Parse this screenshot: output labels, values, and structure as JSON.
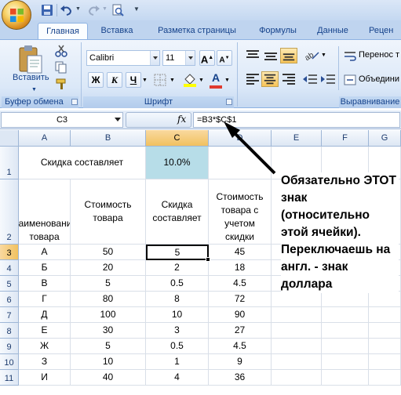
{
  "title_bar": {
    "office_button": "office-logo-icon",
    "quick_access": [
      "save-icon",
      "undo-icon",
      "redo-icon",
      "print-preview-icon",
      "customize-icon"
    ]
  },
  "tabs": [
    "Главная",
    "Вставка",
    "Разметка страницы",
    "Формулы",
    "Данные",
    "Рецен"
  ],
  "ribbon": {
    "clipboard": {
      "paste_label": "Вставить",
      "group_label": "Буфер обмена"
    },
    "font": {
      "font_name": "Calibri",
      "font_size": "11",
      "group_label": "Шрифт",
      "bold": "Ж",
      "italic": "К",
      "underline": "Ч",
      "font_color": "#e03a2f"
    },
    "alignment": {
      "wrap_text": "Перенос т",
      "merge": "Объедини",
      "group_label": "Выравнивание"
    }
  },
  "formula_bar": {
    "name_box": "C3",
    "fx": "fx",
    "formula": "=B3*$C$1"
  },
  "columns": [
    "A",
    "B",
    "C",
    "D",
    "E",
    "F",
    "G"
  ],
  "rows": [
    "1",
    "2",
    "3",
    "4",
    "5",
    "6",
    "7",
    "8",
    "9",
    "10",
    "11"
  ],
  "sheet": {
    "r1": {
      "label": "Скидка составляет",
      "discount": "10.0%"
    },
    "headers": {
      "name": "Наименование товара",
      "price": "Стоимость товара",
      "discount": "Скидка составляет",
      "total": "Стоимость товара с учетом скидки"
    },
    "data": [
      {
        "name": "А",
        "price": "50",
        "discount": "5",
        "total": "45"
      },
      {
        "name": "Б",
        "price": "20",
        "discount": "2",
        "total": "18"
      },
      {
        "name": "В",
        "price": "5",
        "discount": "0.5",
        "total": "4.5"
      },
      {
        "name": "Г",
        "price": "80",
        "discount": "8",
        "total": "72"
      },
      {
        "name": "Д",
        "price": "100",
        "discount": "10",
        "total": "90"
      },
      {
        "name": "Е",
        "price": "30",
        "discount": "3",
        "total": "27"
      },
      {
        "name": "Ж",
        "price": "5",
        "discount": "0.5",
        "total": "4.5"
      },
      {
        "name": "З",
        "price": "10",
        "discount": "1",
        "total": "9"
      },
      {
        "name": "И",
        "price": "40",
        "discount": "4",
        "total": "36"
      }
    ]
  },
  "annotation": "Обязательно ЭТОТ знак (относительно этой ячейки). Переключаешь на англ. - знак доллара",
  "colors": {
    "highlight_cell": "#b7dde8",
    "selected_header": "#f1c15f",
    "ribbon_text": "#15428b"
  }
}
